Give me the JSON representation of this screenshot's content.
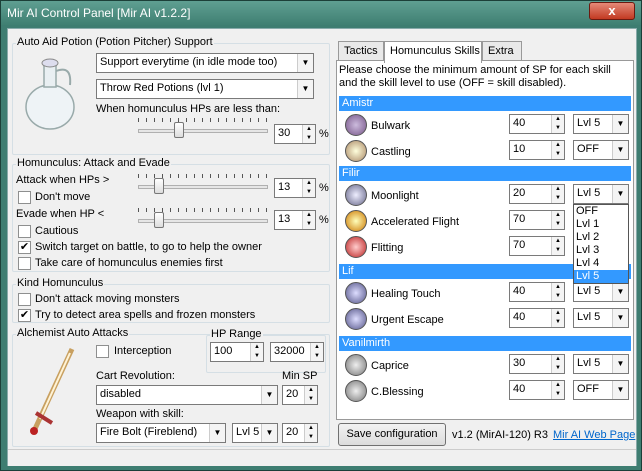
{
  "window": {
    "title": "Mir AI Control Panel [Mir AI v1.2.2]",
    "close": "x"
  },
  "potion": {
    "group_label": "Auto Aid Potion (Potion Pitcher) Support",
    "mode": "Support everytime (in idle mode too)",
    "potion": "Throw Red Potions (lvl 1)",
    "hp_label": "When homunculus HPs are less than:",
    "hp_value": "30",
    "hp_unit": "%",
    "hp_level": 0.3
  },
  "attack": {
    "group_label": "Homunculus: Attack and Evade",
    "attack_label": "Attack when HPs >",
    "attack_value": "13",
    "attack_unit": "%",
    "attack_level": 0.13,
    "dont_move": "Don't move",
    "dont_move_checked": false,
    "evade_label": "Evade when HP <",
    "evade_value": "13",
    "evade_unit": "%",
    "evade_level": 0.13,
    "cautious": "Cautious",
    "cautious_checked": false,
    "switch": "Switch target on battle, to go to help the owner",
    "switch_checked": true,
    "take_care": "Take care of homunculus enemies first",
    "take_care_checked": false
  },
  "kind": {
    "group_label": "Kind Homunculus",
    "dont_attack": "Don't attack moving monsters",
    "dont_attack_checked": false,
    "detect": "Try to detect area spells and frozen monsters",
    "detect_checked": true
  },
  "alchemist": {
    "group_label": "Alchemist Auto Attacks",
    "interception": "Interception",
    "interception_checked": false,
    "hp_range_label": "HP Range",
    "hp_min": "100",
    "hp_max": "32000",
    "cart_label": "Cart Revolution:",
    "cart_value": "disabled",
    "min_sp_label": "Min SP",
    "min_sp_value": "20",
    "weapon_label": "Weapon with skill:",
    "weapon_value": "Fire Bolt (Fireblend)",
    "weapon_level": "Lvl 5",
    "weapon_sp": "20"
  },
  "tabs": {
    "t1": "Tactics",
    "t2": "Homunculus Skills",
    "t3": "Extra"
  },
  "skills": {
    "intro": "Please choose the minimum amount of SP for each skill and the skill level to use (OFF = skill disabled).",
    "amistr": "Amistr",
    "filir": "Filir",
    "lif": "Lif",
    "vanilmirth": "Vanilmirth",
    "bulwark": {
      "name": "Bulwark",
      "sp": "40",
      "lvl": "Lvl 5"
    },
    "castling": {
      "name": "Castling",
      "sp": "10",
      "lvl": "OFF"
    },
    "moonlight": {
      "name": "Moonlight",
      "sp": "20",
      "lvl": "Lvl 5"
    },
    "flight": {
      "name": "Accelerated Flight",
      "sp": "70"
    },
    "flitting": {
      "name": "Flitting",
      "sp": "70"
    },
    "healing": {
      "name": "Healing Touch",
      "sp": "40",
      "lvl": "Lvl 5"
    },
    "escape": {
      "name": "Urgent Escape",
      "sp": "40",
      "lvl": "Lvl 5"
    },
    "caprice": {
      "name": "Caprice",
      "sp": "30",
      "lvl": "Lvl 5"
    },
    "blessing": {
      "name": "C.Blessing",
      "sp": "40",
      "lvl": "OFF"
    },
    "dropdown": [
      "OFF",
      "Lvl 1",
      "Lvl 2",
      "Lvl 3",
      "Lvl 4",
      "Lvl 5"
    ]
  },
  "footer": {
    "save": "Save configuration",
    "version": "v1.2 (MirAI-120) R3",
    "web": "Mir AI Web Page"
  },
  "colors": {
    "title": "#3f7f72",
    "section": "#3399ff"
  }
}
